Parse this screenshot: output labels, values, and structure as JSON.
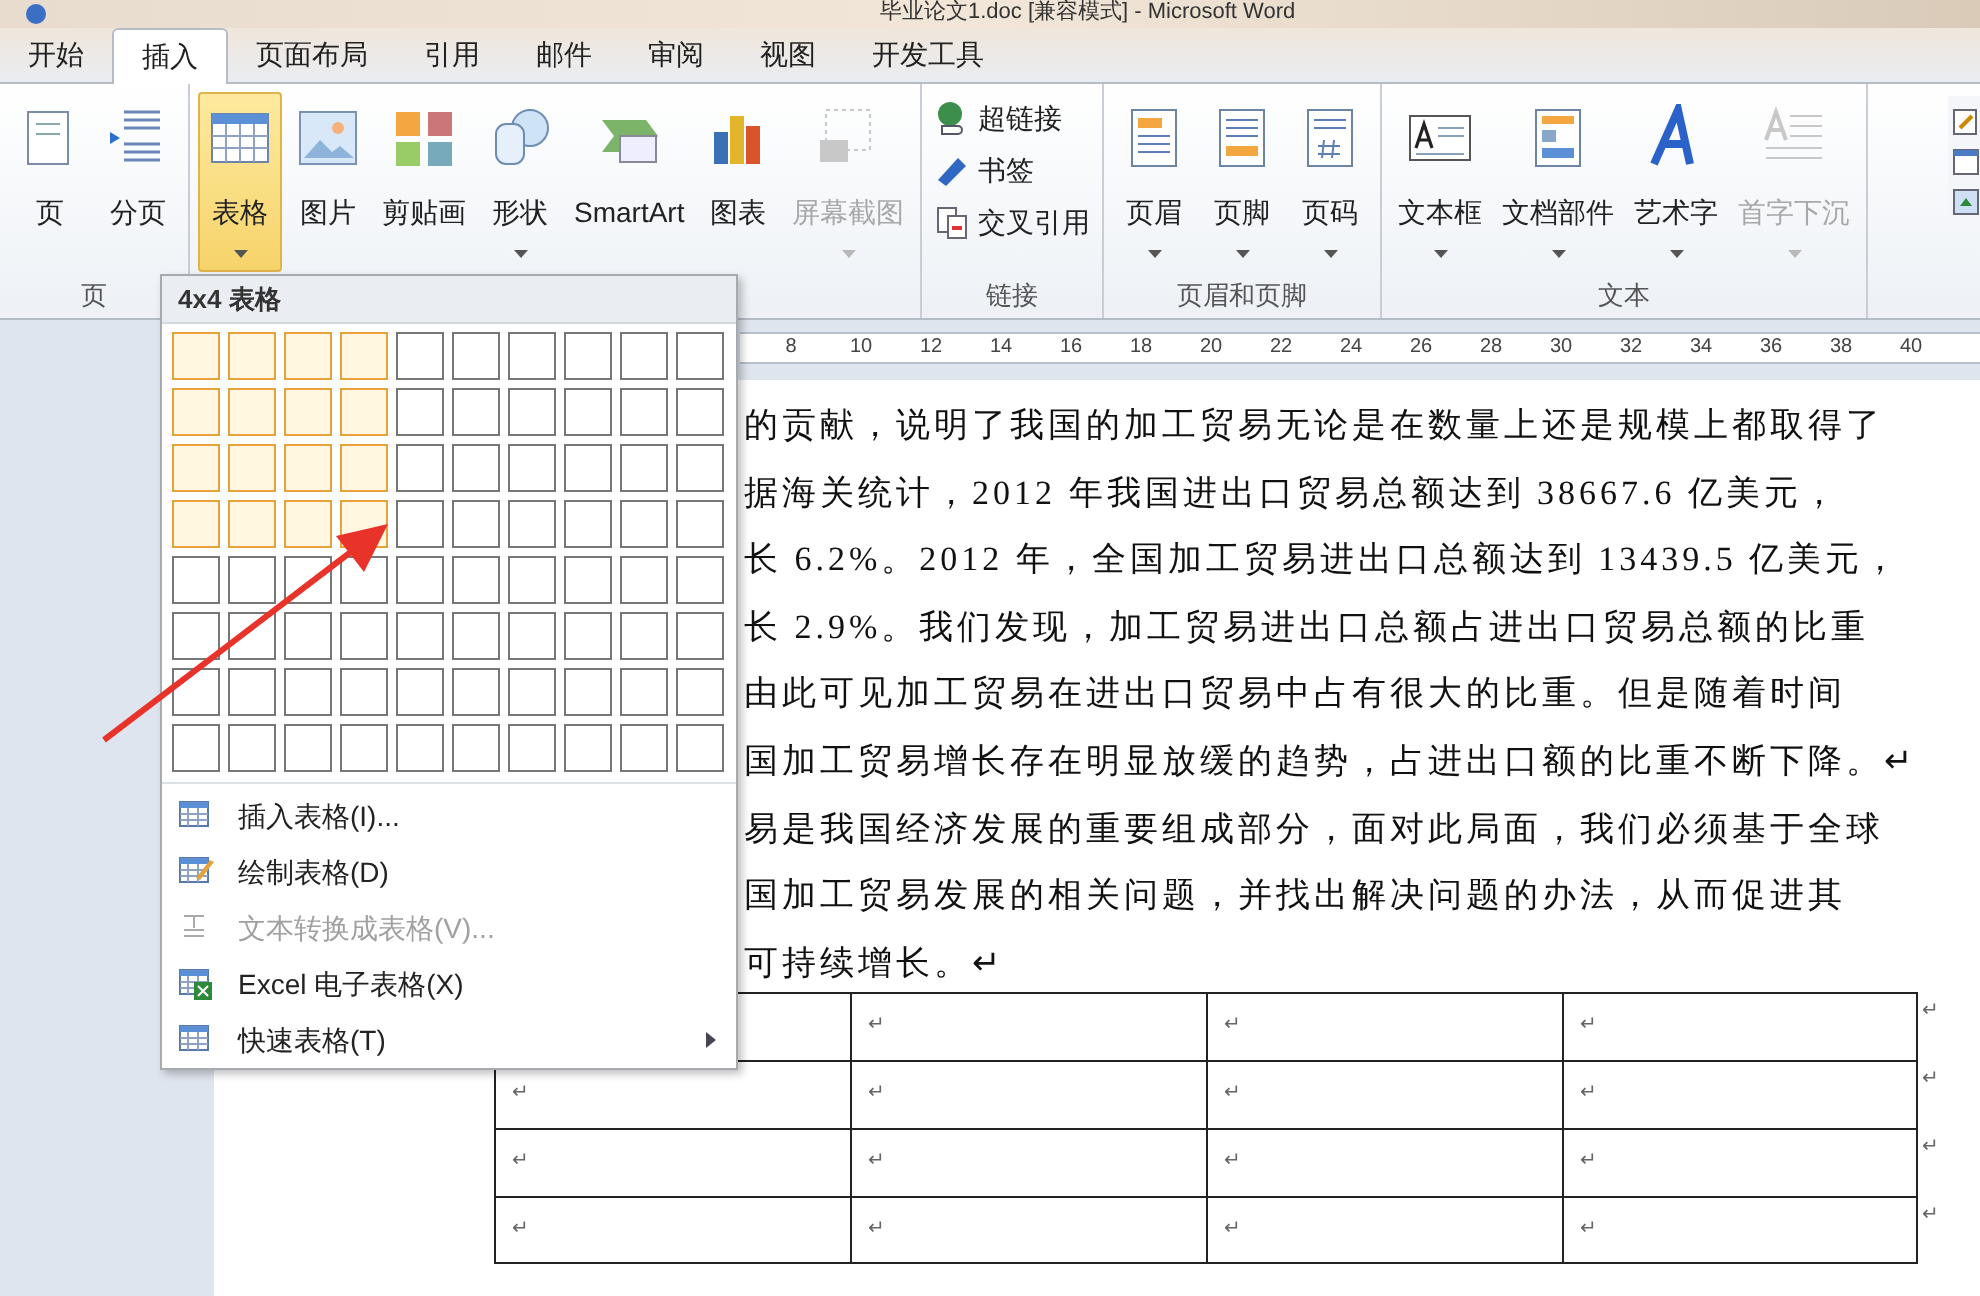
{
  "window": {
    "title": "毕业论文1.doc [兼容模式] - Microsoft Word"
  },
  "tabs": [
    {
      "label": "开始",
      "selected": false
    },
    {
      "label": "插入",
      "selected": true
    },
    {
      "label": "页面布局",
      "selected": false
    },
    {
      "label": "引用",
      "selected": false
    },
    {
      "label": "邮件",
      "selected": false
    },
    {
      "label": "审阅",
      "selected": false
    },
    {
      "label": "视图",
      "selected": false
    },
    {
      "label": "开发工具",
      "selected": false
    }
  ],
  "ribbon": {
    "groups": [
      {
        "label": "页",
        "kind": "large",
        "items": [
          {
            "label": "页",
            "dropdown": false,
            "disabled": false,
            "selected": false
          },
          {
            "label": "分页",
            "dropdown": false,
            "disabled": false,
            "selected": false
          }
        ]
      },
      {
        "kind": "large",
        "items": [
          {
            "label": "表格",
            "dropdown": true,
            "disabled": false,
            "selected": true
          },
          {
            "label": "图片",
            "dropdown": false,
            "disabled": false,
            "selected": false
          },
          {
            "label": "剪贴画",
            "dropdown": false,
            "disabled": false,
            "selected": false
          },
          {
            "label": "形状",
            "dropdown": true,
            "disabled": false,
            "selected": false
          },
          {
            "label": "SmartArt",
            "dropdown": false,
            "disabled": false,
            "selected": false
          },
          {
            "label": "图表",
            "dropdown": false,
            "disabled": false,
            "selected": false
          },
          {
            "label": "屏幕截图",
            "dropdown": true,
            "disabled": true,
            "selected": false
          }
        ]
      },
      {
        "label": "链接",
        "kind": "small",
        "items": [
          {
            "label": "超链接",
            "disabled": false,
            "selected": false
          },
          {
            "label": "书签",
            "disabled": false,
            "selected": false
          },
          {
            "label": "交叉引用",
            "disabled": false,
            "selected": false
          }
        ]
      },
      {
        "label": "页眉和页脚",
        "kind": "large",
        "items": [
          {
            "label": "页眉",
            "dropdown": true,
            "disabled": false,
            "selected": false
          },
          {
            "label": "页脚",
            "dropdown": true,
            "disabled": false,
            "selected": false
          },
          {
            "label": "页码",
            "dropdown": true,
            "disabled": false,
            "selected": false
          }
        ]
      },
      {
        "label": "文本",
        "kind": "large",
        "items": [
          {
            "label": "文本框",
            "dropdown": true,
            "disabled": false,
            "selected": false
          },
          {
            "label": "文档部件",
            "dropdown": true,
            "disabled": false,
            "selected": false
          },
          {
            "label": "艺术字",
            "dropdown": true,
            "disabled": false,
            "selected": false
          },
          {
            "label": "首字下沉",
            "dropdown": true,
            "disabled": true,
            "selected": false
          }
        ]
      }
    ]
  },
  "ruler": {
    "labels": [
      "8",
      "10",
      "12",
      "14",
      "16",
      "18",
      "20",
      "22",
      "24",
      "26",
      "28",
      "30",
      "32",
      "34",
      "36",
      "38",
      "40"
    ]
  },
  "table_menu": {
    "title": "4x4 表格",
    "grid": [
      {
        "cells": [
          {
            "selected": true
          },
          {
            "selected": true
          },
          {
            "selected": true
          },
          {
            "selected": true
          },
          {
            "selected": false
          },
          {
            "selected": false
          },
          {
            "selected": false
          },
          {
            "selected": false
          },
          {
            "selected": false
          },
          {
            "selected": false
          }
        ]
      },
      {
        "cells": [
          {
            "selected": true
          },
          {
            "selected": true
          },
          {
            "selected": true
          },
          {
            "selected": true
          },
          {
            "selected": false
          },
          {
            "selected": false
          },
          {
            "selected": false
          },
          {
            "selected": false
          },
          {
            "selected": false
          },
          {
            "selected": false
          }
        ]
      },
      {
        "cells": [
          {
            "selected": true
          },
          {
            "selected": true
          },
          {
            "selected": true
          },
          {
            "selected": true
          },
          {
            "selected": false
          },
          {
            "selected": false
          },
          {
            "selected": false
          },
          {
            "selected": false
          },
          {
            "selected": false
          },
          {
            "selected": false
          }
        ]
      },
      {
        "cells": [
          {
            "selected": true
          },
          {
            "selected": true
          },
          {
            "selected": true
          },
          {
            "selected": true
          },
          {
            "selected": false
          },
          {
            "selected": false
          },
          {
            "selected": false
          },
          {
            "selected": false
          },
          {
            "selected": false
          },
          {
            "selected": false
          }
        ]
      },
      {
        "cells": [
          {
            "selected": false
          },
          {
            "selected": false
          },
          {
            "selected": false
          },
          {
            "selected": false
          },
          {
            "selected": false
          },
          {
            "selected": false
          },
          {
            "selected": false
          },
          {
            "selected": false
          },
          {
            "selected": false
          },
          {
            "selected": false
          }
        ]
      },
      {
        "cells": [
          {
            "selected": false
          },
          {
            "selected": false
          },
          {
            "selected": false
          },
          {
            "selected": false
          },
          {
            "selected": false
          },
          {
            "selected": false
          },
          {
            "selected": false
          },
          {
            "selected": false
          },
          {
            "selected": false
          },
          {
            "selected": false
          }
        ]
      },
      {
        "cells": [
          {
            "selected": false
          },
          {
            "selected": false
          },
          {
            "selected": false
          },
          {
            "selected": false
          },
          {
            "selected": false
          },
          {
            "selected": false
          },
          {
            "selected": false
          },
          {
            "selected": false
          },
          {
            "selected": false
          },
          {
            "selected": false
          }
        ]
      },
      {
        "cells": [
          {
            "selected": false
          },
          {
            "selected": false
          },
          {
            "selected": false
          },
          {
            "selected": false
          },
          {
            "selected": false
          },
          {
            "selected": false
          },
          {
            "selected": false
          },
          {
            "selected": false
          },
          {
            "selected": false
          },
          {
            "selected": false
          }
        ]
      }
    ],
    "items": [
      {
        "label": "插入表格(I)...",
        "disabled": false,
        "submenu": false
      },
      {
        "label": "绘制表格(D)",
        "disabled": false,
        "submenu": false
      },
      {
        "label": "文本转换成表格(V)...",
        "disabled": true,
        "submenu": false
      },
      {
        "label": "Excel 电子表格(X)",
        "disabled": false,
        "submenu": false
      },
      {
        "label": "快速表格(T)",
        "disabled": false,
        "submenu": true
      }
    ]
  },
  "document": {
    "lines": [
      "的贡献，说明了我国的加工贸易无论是在数量上还是规模上都取得了",
      "据海关统计，2012 年我国进出口贸易总额达到 38667.6 亿美元，",
      "长 6.2%。2012 年，全国加工贸易进出口总额达到 13439.5 亿美元，",
      "长 2.9%。我们发现，加工贸易进出口总额占进出口贸易总额的比重",
      "由此可见加工贸易在进出口贸易中占有很大的比重。但是随着时间",
      "国加工贸易增长存在明显放缓的趋势，占进出口额的比重不断下降。↵",
      "易是我国经济发展的重要组成部分，面对此局面，我们必须基于全球",
      "国加工贸易发展的相关问题，并找出解决问题的办法，从而促进其",
      "可持续增长。↵"
    ],
    "table": {
      "rows": [
        {
          "cells": [
            "",
            "↵",
            "↵",
            "↵"
          ],
          "end_mark": "↵"
        },
        {
          "cells": [
            "↵",
            "↵",
            "↵",
            "↵"
          ],
          "end_mark": "↵"
        },
        {
          "cells": [
            "↵",
            "↵",
            "↵",
            "↵"
          ],
          "end_mark": "↵"
        },
        {
          "cells": [
            "↵",
            "↵",
            "↵",
            "↵"
          ],
          "end_mark": "↵"
        }
      ]
    }
  }
}
